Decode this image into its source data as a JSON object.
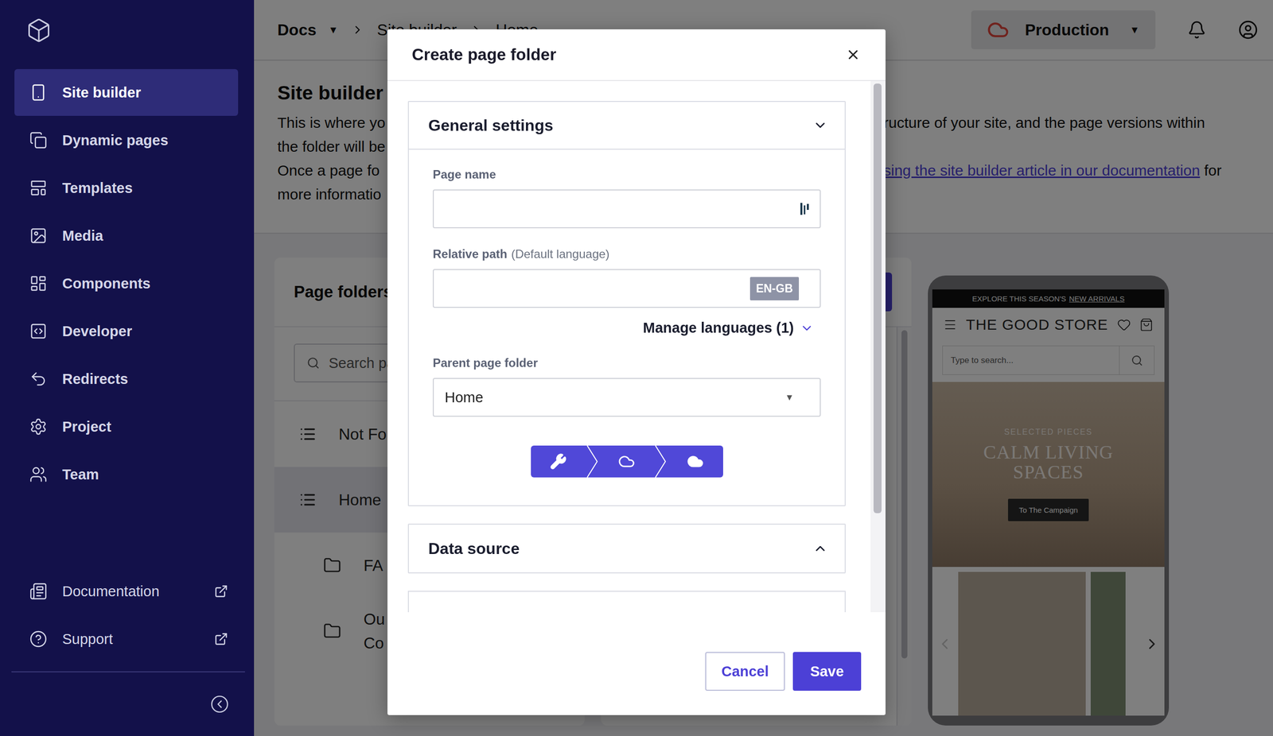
{
  "sidebar": {
    "items": [
      {
        "label": "Site builder",
        "selected": true
      },
      {
        "label": "Dynamic pages",
        "selected": false
      },
      {
        "label": "Templates",
        "selected": false
      },
      {
        "label": "Media",
        "selected": false
      },
      {
        "label": "Components",
        "selected": false
      },
      {
        "label": "Developer",
        "selected": false
      },
      {
        "label": "Redirects",
        "selected": false
      },
      {
        "label": "Project",
        "selected": false
      },
      {
        "label": "Team",
        "selected": false
      }
    ],
    "links": [
      {
        "label": "Documentation"
      },
      {
        "label": "Support"
      }
    ]
  },
  "topbar": {
    "breadcrumb": [
      {
        "label": "Docs",
        "caret": "▼"
      },
      {
        "label": "Site builder",
        "caret": ""
      },
      {
        "label": "Home",
        "caret": ""
      }
    ],
    "environment": {
      "label": "Production",
      "caret": "▼"
    }
  },
  "intro": {
    "title": "Site builder",
    "lines": [
      {
        "left": "This is where yo",
        "right": "ructure of your site, and the page versions within",
        "link": "",
        "after": ""
      },
      {
        "left": "the folder will be",
        "right": "",
        "link": "",
        "after": ""
      },
      {
        "left": "Once a page fo",
        "right": "",
        "link": "sing the site builder article in our documentation",
        "after": " for"
      },
      {
        "left": "more informatio",
        "right": "",
        "link": "",
        "after": ""
      }
    ]
  },
  "page_folders": {
    "title": "Page folders",
    "search_placeholder": "Search pa",
    "rows": [
      {
        "lines": [
          "Not Fo"
        ],
        "kind": "page",
        "selected": false
      },
      {
        "lines": [
          "Home"
        ],
        "kind": "page",
        "selected": true
      },
      {
        "lines": [
          "FA"
        ],
        "kind": "folder",
        "selected": false
      },
      {
        "lines": [
          "Ou",
          "Co"
        ],
        "kind": "folder",
        "selected": false
      }
    ]
  },
  "preview": {
    "announcement": "EXPLORE THIS SEASON'S",
    "announcement_link": "NEW ARRIVALS",
    "store": "THE GOOD STORE",
    "search_placeholder": "Type to search...",
    "hero_kicker": "SELECTED PIECES",
    "hero_title": "CALM LIVING SPACES",
    "hero_button": "To The Campaign"
  },
  "modal": {
    "title": "Create page folder",
    "sections": [
      {
        "title": "General settings",
        "expanded": true
      },
      {
        "title": "Data source",
        "expanded": false
      }
    ],
    "page_name": {
      "label": "Page name",
      "value": ""
    },
    "relative_path": {
      "label": "Relative path",
      "hint": "(Default language)",
      "value": "",
      "badge": "EN-GB"
    },
    "manage_languages": "Manage languages (1)",
    "parent": {
      "label": "Parent page folder",
      "value": "Home",
      "caret": "▼"
    },
    "stepper": [
      {
        "kind": "build"
      },
      {
        "kind": "staging"
      },
      {
        "kind": "production"
      }
    ],
    "buttons": [
      {
        "label": "Cancel",
        "kind": "secondary"
      },
      {
        "label": "Save",
        "kind": "primary"
      }
    ]
  }
}
